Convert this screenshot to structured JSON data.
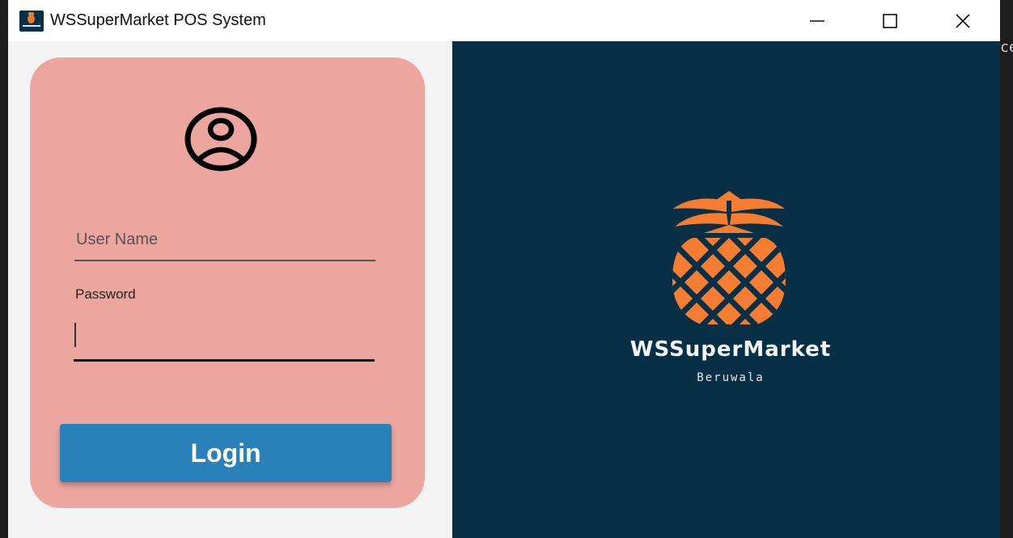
{
  "window": {
    "title": "WSSuperMarket POS System",
    "app_icon": "pineapple-logo-icon",
    "controls": [
      "minimize-icon",
      "maximize-icon",
      "close-icon"
    ]
  },
  "login_form": {
    "user_icon": "user-circle-icon",
    "username": {
      "placeholder": "User Name",
      "value": ""
    },
    "password": {
      "label": "Password",
      "value": ""
    },
    "login_button": "Login"
  },
  "brand": {
    "logo": "pineapple-logo",
    "name": "WSSuperMarket",
    "location": "Beruwala"
  },
  "background_text": "ce",
  "colors": {
    "card": "#eca59f",
    "login_button": "#2a80b9",
    "brand_panel": "#073046",
    "logo_orange": "#f57c30"
  }
}
